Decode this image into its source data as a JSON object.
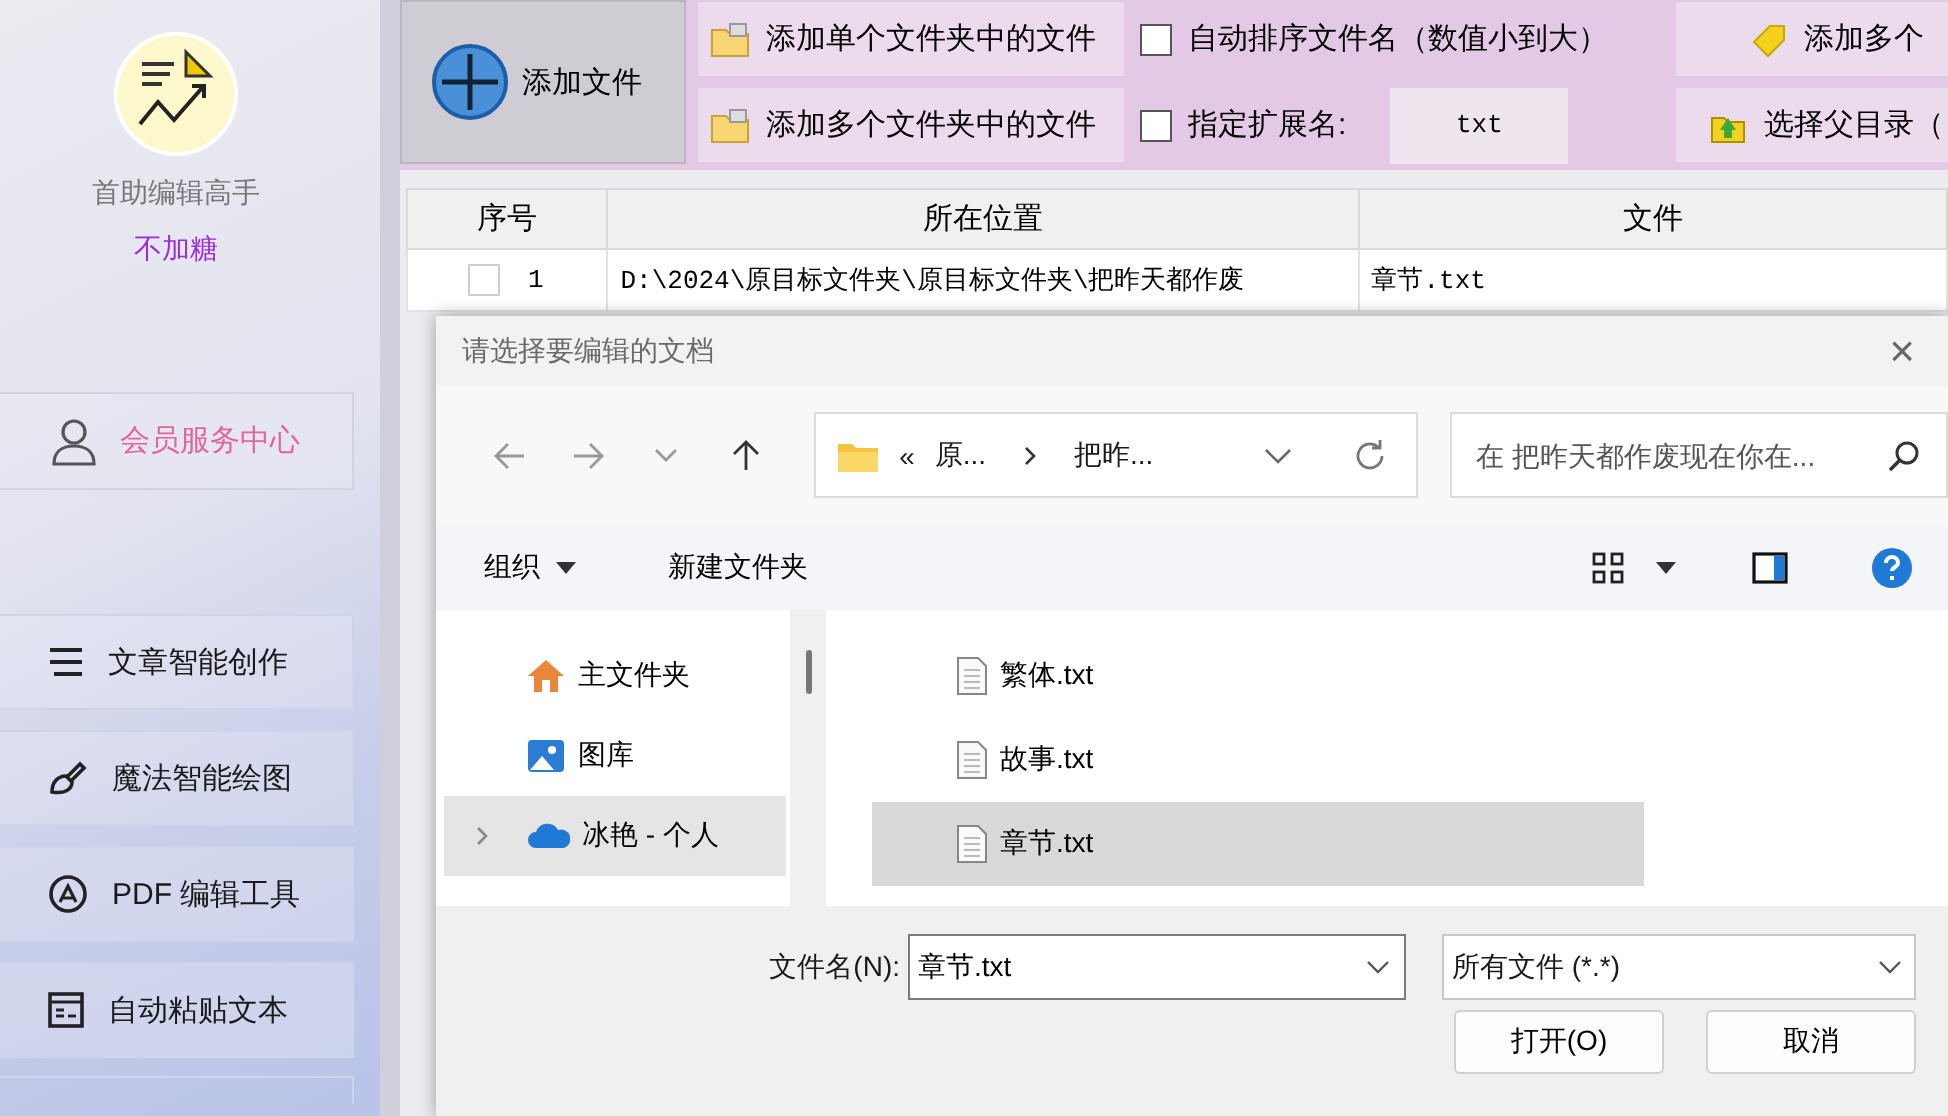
{
  "sidebar": {
    "app_name": "首助编辑高手",
    "user": "不加糖",
    "member_button": "会员服务中心",
    "menu": [
      {
        "label": "文章智能创作",
        "kind": "writing"
      },
      {
        "label": "魔法智能绘图",
        "kind": "brush"
      },
      {
        "label": "PDF 编辑工具",
        "kind": "pdf"
      },
      {
        "label": "自动粘贴文本",
        "kind": "paste"
      }
    ]
  },
  "toolbar": {
    "add_file_button": "添加文件",
    "folder_buttons": [
      "添加单个文件夹中的文件",
      "添加多个文件夹中的文件"
    ],
    "options": [
      {
        "label": "自动排序文件名（数值小到大）",
        "checked": false
      },
      {
        "label": "指定扩展名:",
        "checked": false
      }
    ],
    "extension_field": {
      "value": "txt"
    },
    "right_buttons": [
      {
        "label": "添加多个",
        "kind": "tag"
      },
      {
        "label": "选择父目录（",
        "kind": "folder-arrow"
      }
    ]
  },
  "table": {
    "columns": [
      "序号",
      "所在位置",
      "文件"
    ],
    "rows": [
      {
        "checked": false,
        "index": "1",
        "location": "D:\\2024\\原目标文件夹\\原目标文件夹\\把昨天都作废",
        "file": "章节.txt"
      }
    ]
  },
  "dialog": {
    "title": "请选择要编辑的文档",
    "close": "×",
    "breadcrumb": {
      "overflow": "«",
      "parts": [
        "原...",
        "把昨..."
      ]
    },
    "search": {
      "placeholder": "在 把昨天都作废现在你在..."
    },
    "commands": [
      "组织",
      "新建文件夹"
    ],
    "nav": [
      {
        "label": "主文件夹",
        "kind": "home",
        "selected": false
      },
      {
        "label": "图库",
        "kind": "gallery",
        "selected": false
      },
      {
        "label": "冰艳 - 个人",
        "kind": "cloud",
        "selected": true
      }
    ],
    "files": [
      {
        "name": "繁体.txt",
        "selected": false
      },
      {
        "name": "故事.txt",
        "selected": false
      },
      {
        "name": "章节.txt",
        "selected": true
      }
    ],
    "filename_label": "文件名(N):",
    "filename": {
      "value": "章节.txt"
    },
    "filter": "所有文件 (*.*)",
    "buttons": [
      "打开(O)",
      "取消"
    ]
  }
}
